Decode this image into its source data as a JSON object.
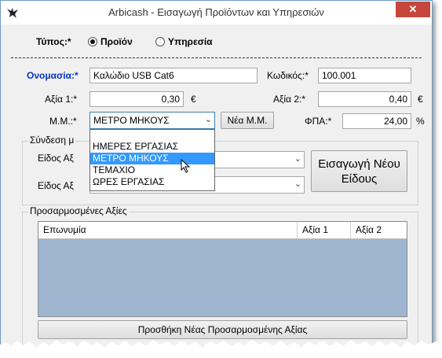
{
  "window": {
    "title": "Arbicash - Εισαγωγή Προϊόντων και Υπηρεσιών",
    "close_symbol": "✕"
  },
  "type": {
    "label": "Τύπος:*",
    "options": [
      "Προϊόν",
      "Υπηρεσία"
    ],
    "selected": "Προϊόν"
  },
  "form": {
    "name_label": "Ονομασία:*",
    "name_value": "Καλώδιο USB Cat6",
    "code_label": "Κωδικός:*",
    "code_value": "100.001",
    "value1_label": "Αξία 1:*",
    "value1_value": "0,30",
    "value1_currency": "€",
    "value2_label": "Αξία 2:*",
    "value2_value": "0,40",
    "value2_currency": "€",
    "unit_label": "Μ.Μ.:*",
    "unit_value": "ΜΕΤΡΟ ΜΗΚΟΥΣ",
    "new_unit_button": "Νέα Μ.Μ.",
    "vat_label": "ΦΠΑ:*",
    "vat_value": "24,00",
    "vat_unit": "%"
  },
  "unit_dropdown": {
    "options": [
      "ΗΜΕΡΕΣ ΕΡΓΑΣΙΑΣ",
      "ΜΕΤΡΟ ΜΗΚΟΥΣ",
      "ΤΕΜΑΧΙΟ",
      "ΩΡΕΣ ΕΡΓΑΣΙΑΣ"
    ],
    "selected": "ΜΕΤΡΟ ΜΗΚΟΥΣ"
  },
  "link_group": {
    "title": "Σύνδεση μ",
    "type1_label": "Είδος Αξ",
    "type2_label": "Είδος Αξ",
    "new_type_button_line1": "Εισαγωγή Νέου",
    "new_type_button_line2": "Είδους"
  },
  "custom_values": {
    "title": "Προσαρμοσμένες Αξίες",
    "columns": [
      "Επωνυμία",
      "Αξία 1",
      "Αξία 2"
    ],
    "add_button": "Προσθήκη Νέας Προσαρμοσμένης Αξίας"
  },
  "colors": {
    "grid_bg": "#9fb6d0",
    "selection": "#3399ff",
    "close_button": "#c7463b",
    "name_label": "#0033cc"
  }
}
